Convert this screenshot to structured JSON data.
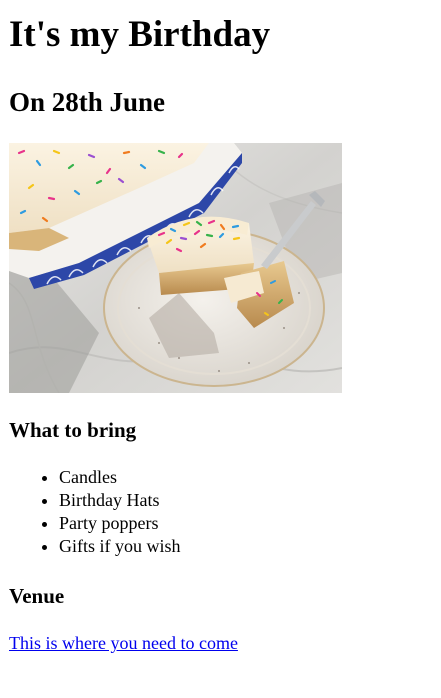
{
  "page": {
    "title": "It's my Birthday",
    "subtitle": "On 28th June"
  },
  "photo": {
    "subject": "cake-photo"
  },
  "bring": {
    "heading": "What to bring",
    "items": [
      "Candles",
      "Birthday Hats",
      "Party poppers",
      "Gifts if you wish"
    ]
  },
  "venue": {
    "heading": "Venue",
    "link_text": "This is where you need to come"
  },
  "colors": {
    "link": "#0000ee",
    "text": "#000000",
    "dish_blue": "#2d47a8"
  }
}
